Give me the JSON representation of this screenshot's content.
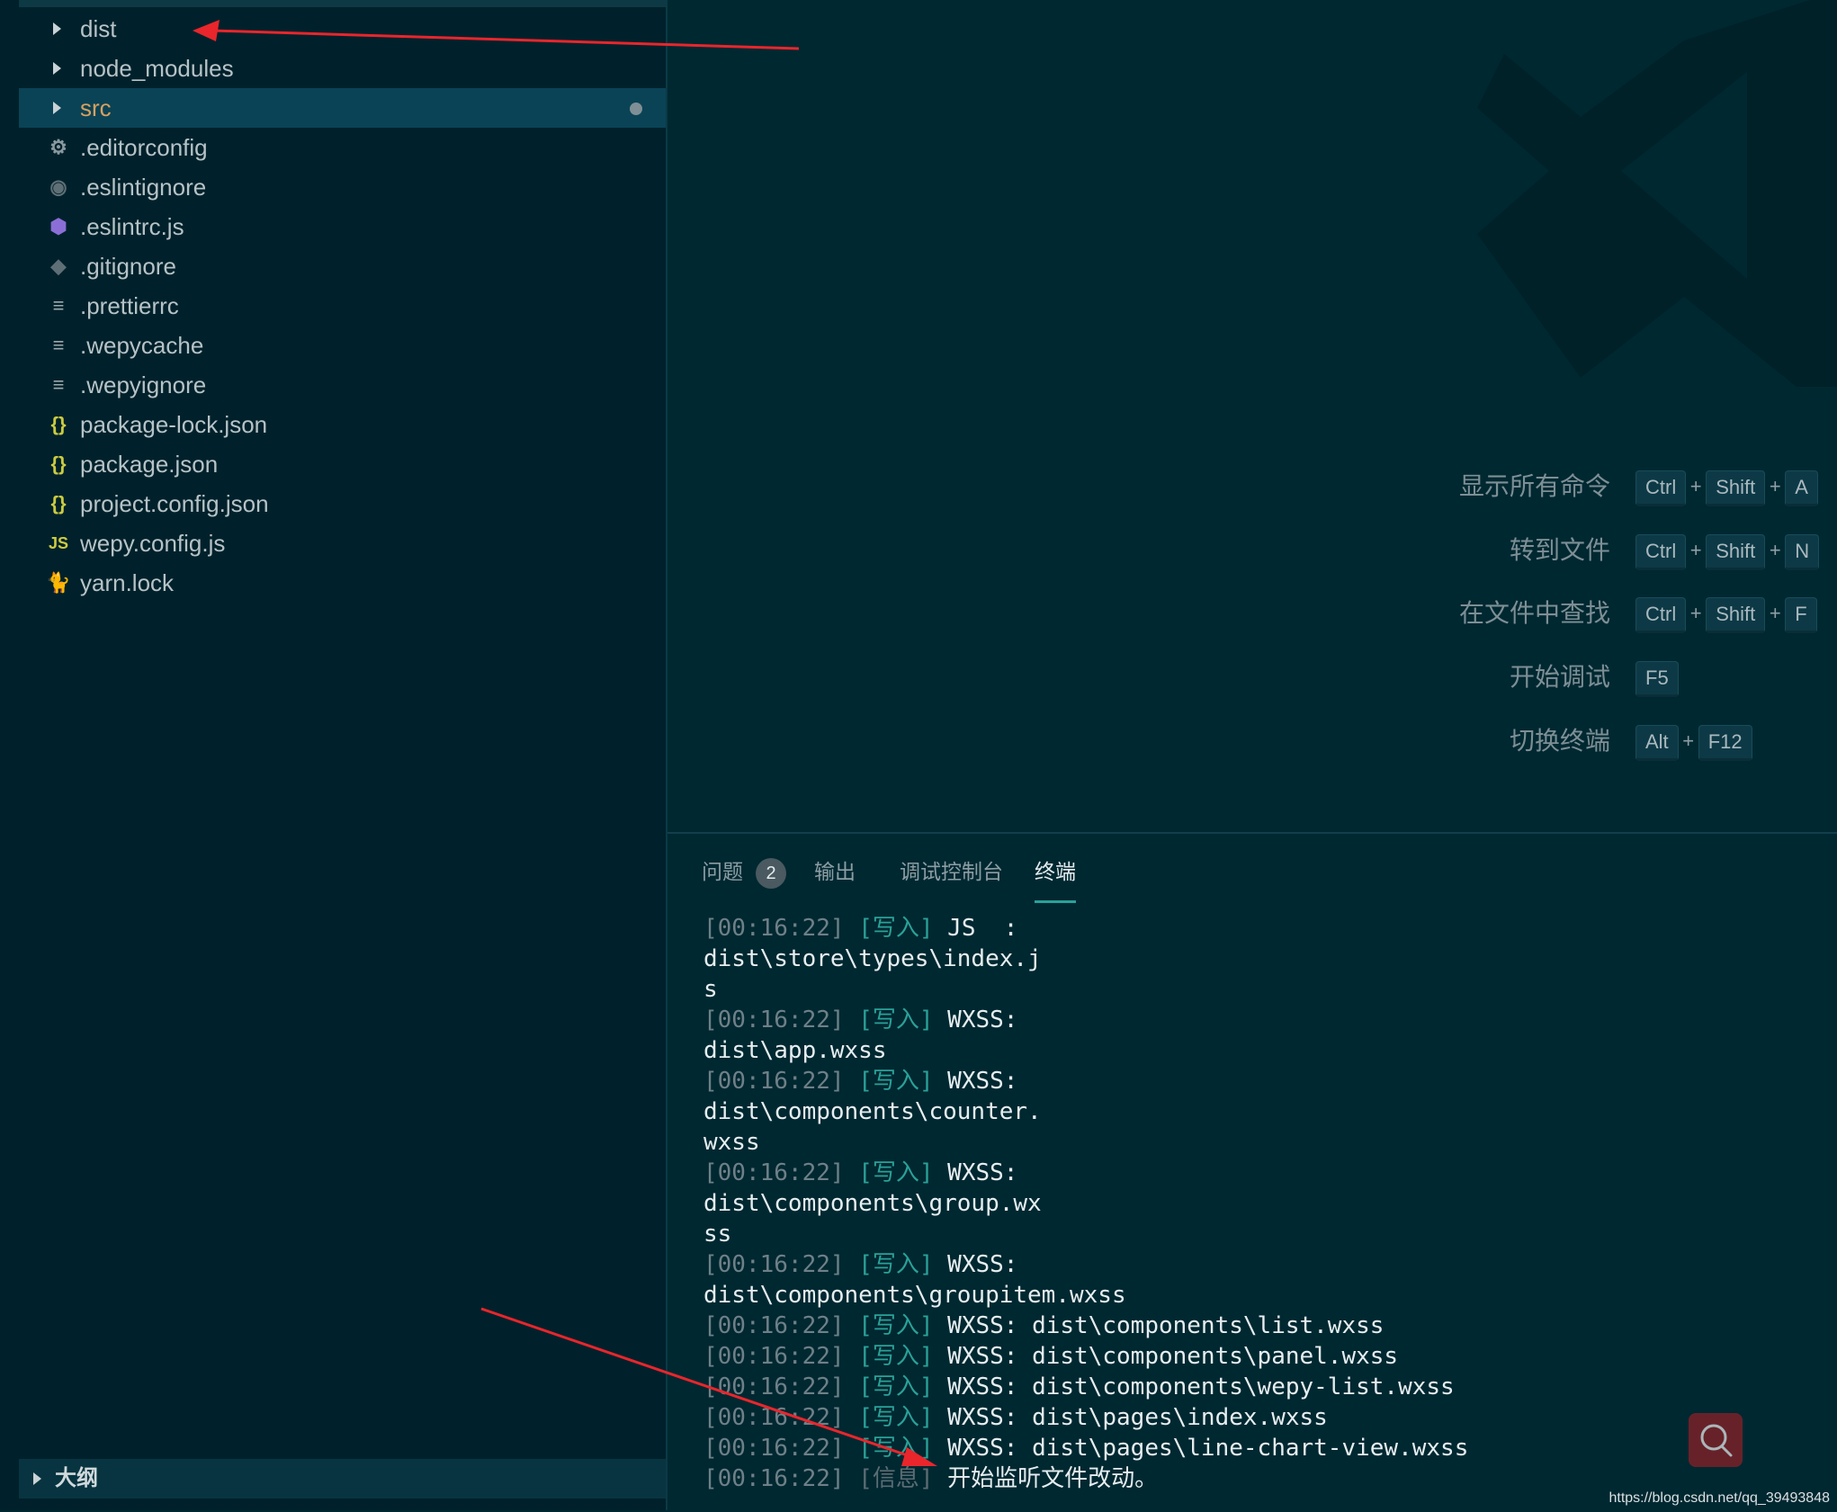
{
  "explorer": {
    "items": [
      {
        "label": "dist",
        "kind": "folder",
        "icon": "chevron-right-icon"
      },
      {
        "label": "node_modules",
        "kind": "folder",
        "icon": "chevron-right-icon"
      },
      {
        "label": "src",
        "kind": "folder",
        "icon": "chevron-right-icon",
        "selected": true,
        "modified": true
      },
      {
        "label": ".editorconfig",
        "kind": "file",
        "icon": "gear-icon",
        "glyph": "⚙",
        "color": "#8a99a0"
      },
      {
        "label": ".eslintignore",
        "kind": "file",
        "icon": "eslint-ignore-icon",
        "glyph": "◉",
        "color": "#5f6f76"
      },
      {
        "label": ".eslintrc.js",
        "kind": "file",
        "icon": "eslint-icon",
        "glyph": "⬢",
        "color": "#8b6fd6"
      },
      {
        "label": ".gitignore",
        "kind": "file",
        "icon": "git-icon",
        "glyph": "◆",
        "color": "#5f6f76"
      },
      {
        "label": ".prettierrc",
        "kind": "file",
        "icon": "text-lines-icon",
        "glyph": "≡",
        "color": "#9aa8ad"
      },
      {
        "label": ".wepycache",
        "kind": "file",
        "icon": "text-lines-icon",
        "glyph": "≡",
        "color": "#9aa8ad"
      },
      {
        "label": ".wepyignore",
        "kind": "file",
        "icon": "text-lines-icon",
        "glyph": "≡",
        "color": "#9aa8ad"
      },
      {
        "label": "package-lock.json",
        "kind": "file",
        "icon": "json-braces-icon",
        "glyph": "{}",
        "color": "#cbcb41"
      },
      {
        "label": "package.json",
        "kind": "file",
        "icon": "json-braces-icon",
        "glyph": "{}",
        "color": "#cbcb41"
      },
      {
        "label": "project.config.json",
        "kind": "file",
        "icon": "json-braces-icon",
        "glyph": "{}",
        "color": "#cbcb41"
      },
      {
        "label": "wepy.config.js",
        "kind": "file",
        "icon": "js-icon",
        "glyph": "JS",
        "color": "#cbcb41"
      },
      {
        "label": "yarn.lock",
        "kind": "file",
        "icon": "yarn-icon",
        "glyph": "🐈",
        "color": "#4aa3c4"
      }
    ],
    "outline_label": "大纲"
  },
  "shortcuts": [
    {
      "label": "显示所有命令",
      "keys": [
        "Ctrl",
        "Shift",
        "A"
      ]
    },
    {
      "label": "转到文件",
      "keys": [
        "Ctrl",
        "Shift",
        "N"
      ]
    },
    {
      "label": "在文件中查找",
      "keys": [
        "Ctrl",
        "Shift",
        "F"
      ]
    },
    {
      "label": "开始调试",
      "keys": [
        "F5"
      ]
    },
    {
      "label": "切换终端",
      "keys": [
        "Alt",
        "F12"
      ]
    }
  ],
  "panel": {
    "tabs": [
      {
        "label": "问题",
        "badge": "2"
      },
      {
        "label": "输出"
      },
      {
        "label": "调试控制台"
      },
      {
        "label": "终端",
        "active": true
      }
    ],
    "terminal_lines": [
      {
        "ts": "[00:16:22]",
        "tag": "[写入]",
        "text": " JS  :"
      },
      {
        "text": "dist\\store\\types\\index.j"
      },
      {
        "text": "s"
      },
      {
        "ts": "[00:16:22]",
        "tag": "[写入]",
        "text": " WXSS:"
      },
      {
        "text": "dist\\app.wxss"
      },
      {
        "ts": "[00:16:22]",
        "tag": "[写入]",
        "text": " WXSS:"
      },
      {
        "text": "dist\\components\\counter."
      },
      {
        "text": "wxss"
      },
      {
        "ts": "[00:16:22]",
        "tag": "[写入]",
        "text": " WXSS:"
      },
      {
        "text": "dist\\components\\group.wx"
      },
      {
        "text": "ss"
      },
      {
        "ts": "[00:16:22]",
        "tag": "[写入]",
        "text": " WXSS:"
      },
      {
        "text": "dist\\components\\groupitem.wxss"
      },
      {
        "ts": "[00:16:22]",
        "tag": "[写入]",
        "text": " WXSS: dist\\components\\list.wxss"
      },
      {
        "ts": "[00:16:22]",
        "tag": "[写入]",
        "text": " WXSS: dist\\components\\panel.wxss"
      },
      {
        "ts": "[00:16:22]",
        "tag": "[写入]",
        "text": " WXSS: dist\\components\\wepy-list.wxss"
      },
      {
        "ts": "[00:16:22]",
        "tag": "[写入]",
        "text": " WXSS: dist\\pages\\index.wxss"
      },
      {
        "ts": "[00:16:22]",
        "tag": "[写入]",
        "text": " WXSS: dist\\pages\\line-chart-view.wxss"
      },
      {
        "ts": "[00:16:22]",
        "tag": "[信息]",
        "text": " 开始监听文件改动。",
        "info": true
      }
    ]
  },
  "watermark_text": "https://blog.csdn.net/qq_39493848",
  "colors": {
    "accent": "#2aa198",
    "annotation": "#e8262c",
    "selected_folder": "#d7a05f"
  }
}
